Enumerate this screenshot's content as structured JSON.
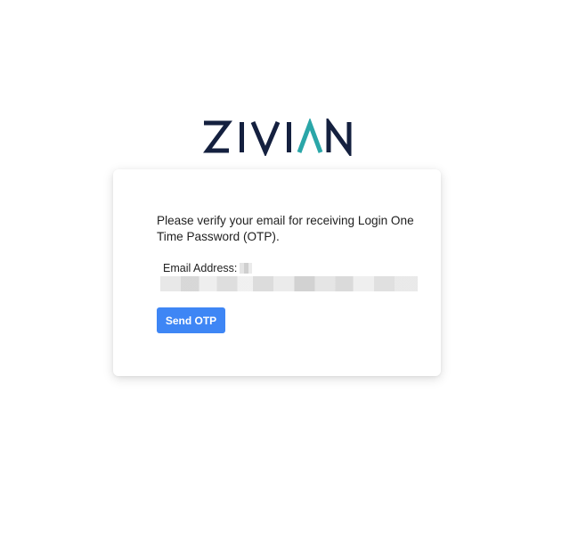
{
  "brand": {
    "name": "ZIVIAN",
    "color_dark": "#14203f",
    "color_accent": "#2aa6a8"
  },
  "verify": {
    "message": "Please verify your email for receiving Login One Time Password (OTP).",
    "email_label": "Email Address:",
    "email_value_redacted": true,
    "send_button_label": "Send OTP",
    "button_color": "#3e86f5"
  }
}
